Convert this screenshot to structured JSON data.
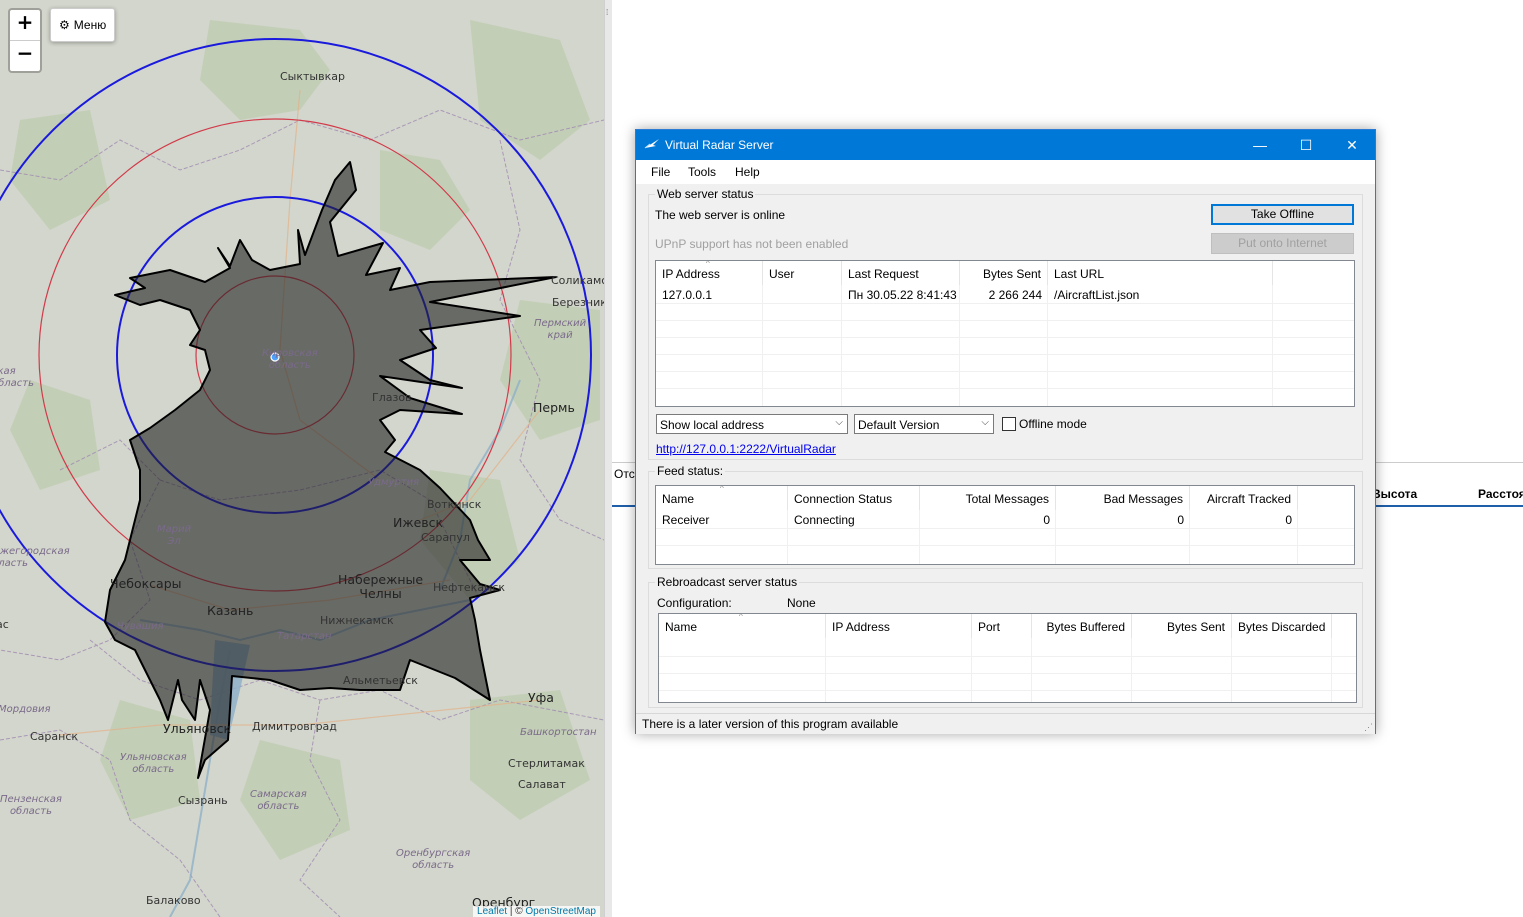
{
  "map": {
    "zoom_in": "+",
    "zoom_out": "−",
    "menu_label": "Меню",
    "menu_icon": "gear-icon",
    "attribution_leaflet": "Leaflet",
    "attribution_sep": " | © ",
    "attribution_osm": "OpenStreetMap",
    "labels": {
      "syktyvkar": "Сыктывкар",
      "solikamsk": "Соликамск",
      "berezniki": "Березники",
      "perm_region": "Пермский\nкрай",
      "kirov_region": "Кировская\nобласть",
      "perm": "Пермь",
      "glazov": "Глазов",
      "udmurtia": "Удмуртия",
      "votkinsk": "Воткинск",
      "izhevsk": "Ижевск",
      "sarapul": "Сарапул",
      "mari_el": "Марий\nЭл",
      "cheboksary": "Чебоксары",
      "kazan": "Казань",
      "nab_chelny": "Набережные\nЧелны",
      "neftekamsk": "Нефтекамск",
      "nizhnekamsk": "Нижнекамск",
      "tatarstan": "Татарстан",
      "almetyevsk": "Альметьевск",
      "chuvashia": "Чувашия",
      "nizhny_region": "Нижегородская\nобласть",
      "kirov_left": "ская\nобласть",
      "mordovia": "Мордовия",
      "saransk": "Саранск",
      "ulyanovsk": "Ульяновск",
      "dimitrovgrad": "Димитровград",
      "ulyanovsk_region": "Ульяновская\nобласть",
      "ufa": "Уфа",
      "bashkortostan": "Башкортостан",
      "sterlitamak": "Стерлитамак",
      "salavat": "Салават",
      "penza_region": "Пензенская\nобласть",
      "syzran": "Сызрань",
      "samara_region": "Самарская\nобласть",
      "orenburg_region": "Оренбургская\nобласть",
      "balakovo": "Балаково",
      "orenburg": "Оренбург",
      "left_ec": "ас"
    }
  },
  "background_panel": {
    "tab_fragment": "Отс",
    "col_altitude": "Высота",
    "col_distance": "Расстоя"
  },
  "window": {
    "title": "Virtual Radar Server",
    "title_icon": "radar-plane-icon",
    "btn_minimize": "—",
    "btn_maximize": "☐",
    "btn_close": "✕",
    "menu": [
      "File",
      "Tools",
      "Help"
    ],
    "web_server": {
      "group_title": "Web server status",
      "status_text": "The web server is online",
      "upnp_text": "UPnP support has not been enabled",
      "take_offline": "Take Offline",
      "put_onto_internet": "Put onto Internet",
      "columns": [
        "IP Address",
        "User",
        "Last Request",
        "Bytes Sent",
        "Last URL"
      ],
      "rows": [
        [
          "127.0.0.1",
          "",
          "Пн 30.05.22 8:41:43",
          "2 266 244",
          "/AircraftList.json"
        ]
      ],
      "address_combo": "Show local address",
      "version_combo": "Default Version",
      "offline_mode_label": "Offline mode",
      "url_link": "http://127.0.0.1:2222/VirtualRadar"
    },
    "feed": {
      "group_title": "Feed status:",
      "columns": [
        "Name",
        "Connection Status",
        "Total Messages",
        "Bad Messages",
        "Aircraft Tracked"
      ],
      "rows": [
        [
          "Receiver",
          "Connecting",
          "0",
          "0",
          "0"
        ]
      ]
    },
    "rebroadcast": {
      "group_title": "Rebroadcast server status",
      "config_label": "Configuration:",
      "config_value": "None",
      "columns": [
        "Name",
        "IP Address",
        "Port",
        "Bytes Buffered",
        "Bytes Sent",
        "Bytes Discarded"
      ]
    },
    "status_bar": "There is a later version of this program available"
  }
}
